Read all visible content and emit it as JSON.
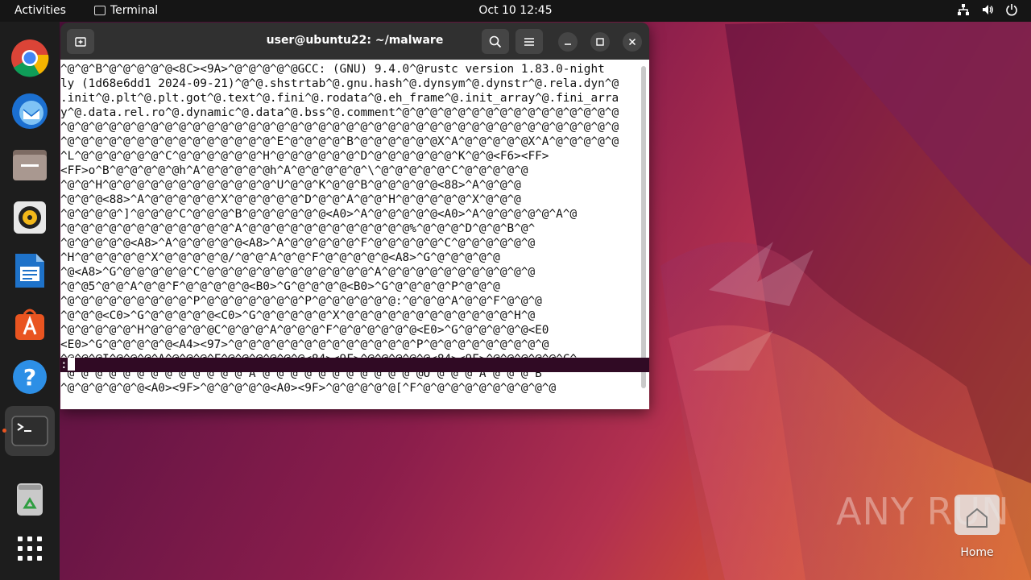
{
  "topbar": {
    "activities": "Activities",
    "app_name": "Terminal",
    "clock": "Oct 10  12:45"
  },
  "dock": {
    "items": [
      "chrome-icon",
      "thunderbird-icon",
      "files-icon",
      "rhythmbox-icon",
      "libreoffice-writer-icon",
      "app-center-icon",
      "help-icon",
      "terminal-icon",
      "trash-icon",
      "app-grid-icon"
    ],
    "running_accent": "#e95420"
  },
  "terminal": {
    "title": "user@ubuntu22: ~/malware",
    "lines": [
      "^@^@^B^@^@^@^@^@<8C><9A>^@^@^@^@^@GCC: (GNU) 9.4.0^@rustc version 1.83.0-night",
      "ly (1d68e6dd1 2024-09-21)^@^@.shstrtab^@.gnu.hash^@.dynsym^@.dynstr^@.rela.dyn^@",
      ".init^@.plt^@.plt.got^@.text^@.fini^@.rodata^@.eh_frame^@.init_array^@.fini_arra",
      "y^@.data.rel.ro^@.dynamic^@.data^@.bss^@.comment^@^@^@^@^@^@^@^@^@^@^@^@^@^@^@^@",
      "^@^@^@^@^@^@^@^@^@^@^@^@^@^@^@^@^@^@^@^@^@^@^@^@^@^@^@^@^@^@^@^@^@^@^@^@^@^@^@^@",
      "^@^@^@^@^@^@^@^@^@^@^@^@^@^@^@^E^@^@^@^@^B^@^@^@^@^@^@X^A^@^@^@^@^@X^A^@^@^@^@^@",
      "^L^@^@^@^@^@^@^C^@^@^@^@^@^@^H^@^@^@^@^@^@^D^@^@^@^@^@^@^K^@^@<F6><FF>",
      "<FF>o^B^@^@^@^@^@h^A^@^@^@^@^@h^A^@^@^@^@^@^\\^@^@^@^@^@^C^@^@^@^@^@",
      "^@^@^H^@^@^@^@^@^@^@^@^@^@^@^@^U^@^@^K^@^@^B^@^@^@^@^@<88>^A^@^@^@",
      "^@^@^@<88>^A^@^@^@^@^@^X^@^@^@^@^@^D^@^@^A^@^@^H^@^@^@^@^@^X^@^@^@",
      "^@^@^@^@^]^@^@^@^C^@^@^@^B^@^@^@^@^@^@<A0>^A^@^@^@^@^@<A0>^A^@^@^@^@^@^A^@",
      "^@^@^@^@^@^@^@^@^@^@^@^@^A^@^@^@^@^@^@^@^@^@^@^@^@%^@^@^@^D^@^@^B^@^",
      "^@^@^@^@^@<A8>^A^@^@^@^@^@<A8>^A^@^@^@^@^@^F^@^@^@^@^@^C^@^@^@^@^@^@",
      "^H^@^@^@^@^@^X^@^@^@^@^@/^@^@^A^@^@^F^@^@^@^@^@<A8>^G^@^@^@^@^@",
      "^@<A8>^G^@^@^@^@^@^C^@^@^@^@^@^@^@^@^@^@^@^@^A^@^@^@^@^@^@^@^@^@^@^@",
      "^@^@5^@^@^A^@^@^F^@^@^@^@^@<B0>^G^@^@^@^@<B0>^G^@^@^@^@^P^@^@^@",
      "^@^@^@^@^@^@^@^@^@^P^@^@^@^@^@^@^@^P^@^@^@^@^@^@:^@^@^@^A^@^@^F^@^@^@",
      "^@^@^@<C0>^G^@^@^@^@^@<C0>^G^@^@^@^@^@^X^@^@^@^@^@^@^@^@^@^@^@^@^H^@",
      "^@^@^@^@^@^H^@^@^@^@^@C^@^@^@^A^@^@^@^F^@^@^@^@^@^@<E0>^G^@^@^@^@^@<E0",
      "<E0>^G^@^@^@^@^@<A4><97>^@^@^@^@^@^@^@^@^@^@^@^@^@^P^@^@^@^@^@^@^@^@^@",
      "^@^@^@I^@^@^@^A^@^@^@^F^@^@^@^@^@^@<84><9F>^@^@^@^@^@<84><9F>^@^@^@^@^@^C^",
      "^@^@^@^@^@^@^@^@^@^@^@^@^@^A^@^@^@^@^@^@^@^@^@^@^@^@O^@^@^@^A^@^@^@^B^",
      "^@^@^@^@^@^@<A0><9F>^@^@^@^@^@<A0><9F>^@^@^@^@^@[^F^@^@^@^@^@^@^@^@^@^@"
    ],
    "prompt": ":"
  },
  "watermark": {
    "text": "ANY RUN"
  },
  "desktop": {
    "home_label": "Home"
  }
}
